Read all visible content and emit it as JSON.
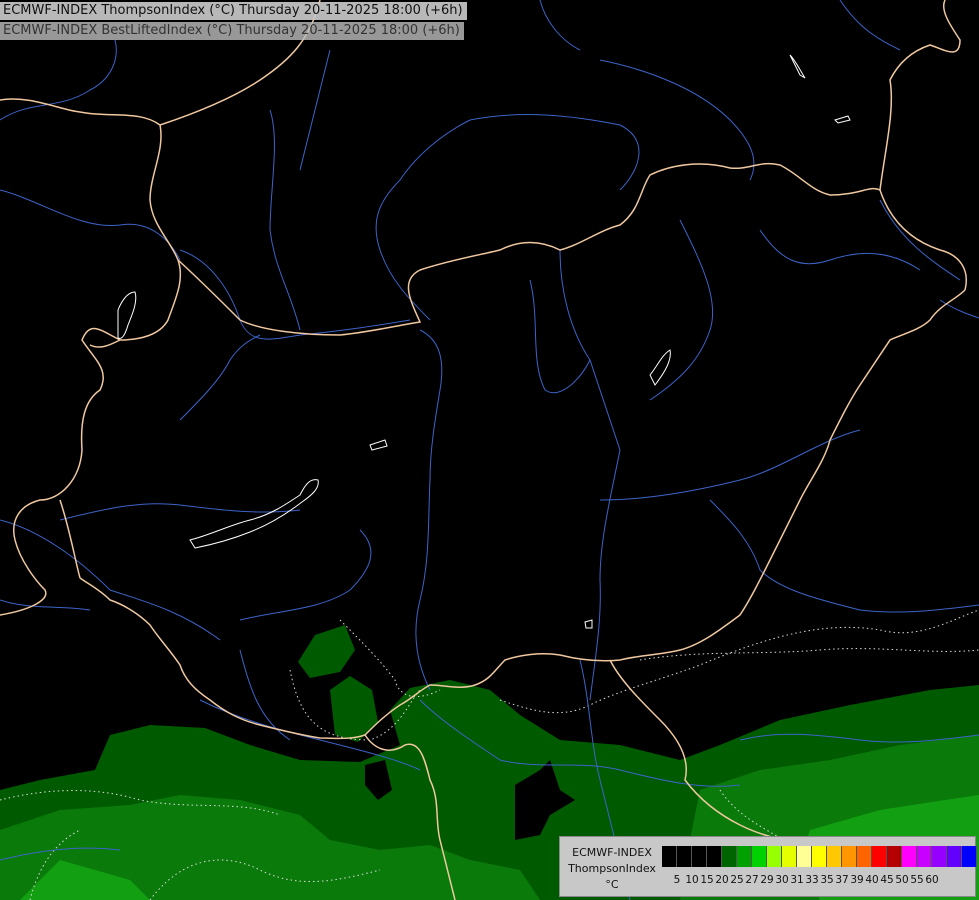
{
  "title": {
    "line1": "ECMWF-INDEX ThompsonIndex (°C) Thursday 20-11-2025 18:00 (+6h)",
    "line2": "ECMWF-INDEX BestLiftedIndex (°C) Thursday 20-11-2025 18:00 (+6h)"
  },
  "legend": {
    "line1": "ECMWF-INDEX",
    "line2": "ThompsonIndex",
    "line3": "°C",
    "colors": [
      "#000000",
      "#000000",
      "#000000",
      "#000000",
      "#006400",
      "#00a000",
      "#00d200",
      "#96ff00",
      "#e6ff00",
      "#ffff96",
      "#ffff00",
      "#ffc800",
      "#ff9600",
      "#ff6400",
      "#ff0000",
      "#b40000",
      "#ff00ff",
      "#c800ff",
      "#9600ff",
      "#6400ff",
      "#0000ff"
    ],
    "ticks": [
      "5",
      "10",
      "15",
      "20",
      "25",
      "27",
      "29",
      "30",
      "31",
      "33",
      "35",
      "37",
      "39",
      "40",
      "45",
      "50",
      "55",
      "60"
    ]
  },
  "map_colors": {
    "background": "#000000",
    "index_dark": "#005a00",
    "index_mid": "#0a7a0a",
    "index_light": "#12a012",
    "border": "#f0c8a0",
    "river": "#3c64c8",
    "lake": "#ffffff",
    "contour": "#dcdcdc"
  }
}
